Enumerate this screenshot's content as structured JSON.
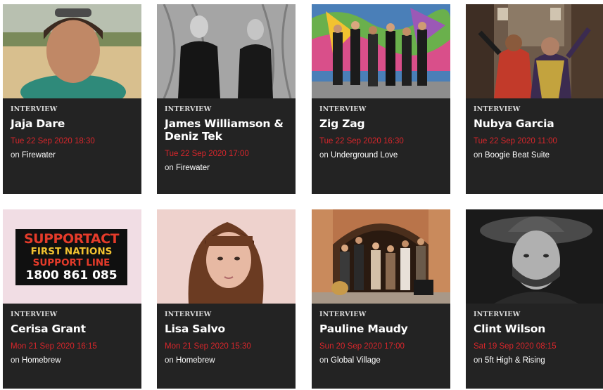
{
  "cards": [
    {
      "kicker": "INTERVIEW",
      "name": "Jaja Dare",
      "datetime": "Tue 22 Sep 2020 18:30",
      "on": "on",
      "show": "Firewater"
    },
    {
      "kicker": "INTERVIEW",
      "name": "James Williamson & Deniz Tek",
      "datetime": "Tue 22 Sep 2020 17:00",
      "on": "on",
      "show": "Firewater"
    },
    {
      "kicker": "INTERVIEW",
      "name": "Zig Zag",
      "datetime": "Tue 22 Sep 2020 16:30",
      "on": "on",
      "show": "Underground Love"
    },
    {
      "kicker": "INTERVIEW",
      "name": "Nubya Garcia",
      "datetime": "Tue 22 Sep 2020 11:00",
      "on": "on",
      "show": "Boogie Beat Suite"
    },
    {
      "kicker": "INTERVIEW",
      "name": "Cerisa Grant",
      "datetime": "Mon 21 Sep 2020 16:15",
      "on": "on",
      "show": "Homebrew"
    },
    {
      "kicker": "INTERVIEW",
      "name": "Lisa Salvo",
      "datetime": "Mon 21 Sep 2020 15:30",
      "on": "on",
      "show": "Homebrew"
    },
    {
      "kicker": "INTERVIEW",
      "name": "Pauline Maudy",
      "datetime": "Sun 20 Sep 2020 17:00",
      "on": "on",
      "show": "Global Village"
    },
    {
      "kicker": "INTERVIEW",
      "name": "Clint Wilson",
      "datetime": "Sat 19 Sep 2020 08:15",
      "on": "on",
      "show": "5ft High & Rising"
    }
  ],
  "supportact_image": {
    "line1": "SUPPORTACT",
    "line2": "FIRST NATIONS",
    "line3": "SUPPORT LINE",
    "line4": "1800 861 085"
  },
  "colors": {
    "card_bg": "#232323",
    "date_red": "#d8262b",
    "name_white": "#ffffff"
  }
}
